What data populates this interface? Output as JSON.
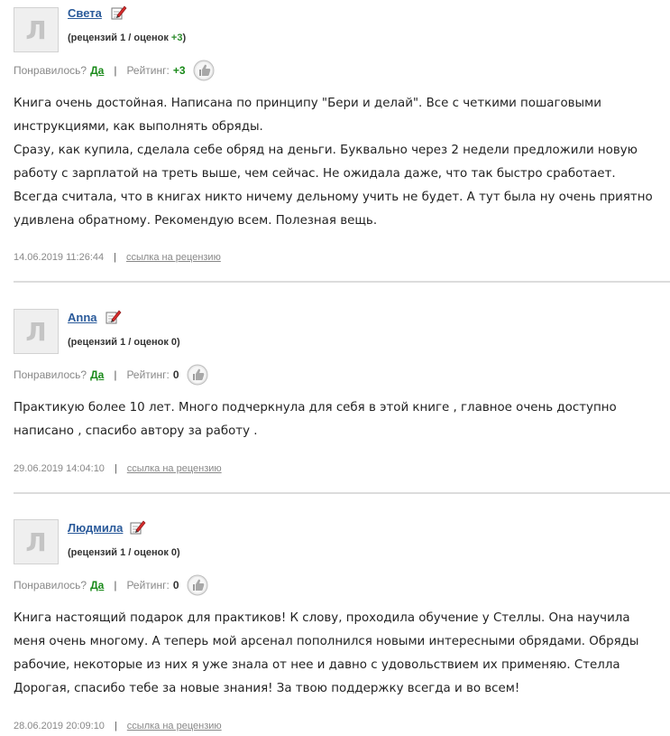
{
  "labels": {
    "liked": "Понравилось?",
    "yes": "Да",
    "rating": "Рейтинг:",
    "link": "ссылка на рецензию",
    "separator": "|"
  },
  "reviews": [
    {
      "avatar_letter": "Л",
      "author": "Света",
      "stats_prefix": "(рецензий 1 / оценок ",
      "stats_value": "+3",
      "stats_suffix": ")",
      "rating": "+3",
      "paragraphs": [
        "Книга очень достойная. Написана по принципу \"Бери и делай\". Все с четкими пошаговыми инструкциями, как выполнять обряды.",
        "Сразу, как купила, сделала себе обряд на деньги. Буквально через 2 недели предложили новую работу с зарплатой на треть выше, чем сейчас. Не ожидала даже, что так быстро сработает. Всегда считала, что в книгах никто ничему дельному учить не будет. А тут была ну очень приятно удивлена обратному. Рекомендую всем. Полезная вещь."
      ],
      "date": "14.06.2019 11:26:44"
    },
    {
      "avatar_letter": "Л",
      "author": "Anna",
      "stats_prefix": "(рецензий 1 / оценок ",
      "stats_value": "0",
      "stats_suffix": ")",
      "rating": "0",
      "paragraphs": [
        "Практикую более 10 лет. Много подчеркнула для себя в этой книге , главное очень доступно написано , спасибо автору за работу ."
      ],
      "date": "29.06.2019 14:04:10"
    },
    {
      "avatar_letter": "Л",
      "author": "Людмила",
      "stats_prefix": "(рецензий 1 / оценок ",
      "stats_value": "0",
      "stats_suffix": ")",
      "rating": "0",
      "paragraphs": [
        "Книга настоящий подарок для практиков! К слову, проходила обучение у Стеллы. Она научила меня очень многому. А теперь мой арсенал пополнился новыми интересными обрядами. Обряды рабочие, некоторые из них я уже знала от нее и давно с удовольствием их применяю. Стелла Дорогая, спасибо тебе за новые знания! За твою поддержку всегда и во всем!"
      ],
      "date": "28.06.2019 20:09:10"
    }
  ],
  "colors": {
    "author_link": "#2a5a9a",
    "yes_link": "#1a8a1a",
    "positive_rating": "#2a8a2a",
    "meta_text": "#888888",
    "divider": "#dcdcdc"
  },
  "icons": {
    "edit": "pencil-edit-icon",
    "vote": "thumbs-up-icon"
  }
}
